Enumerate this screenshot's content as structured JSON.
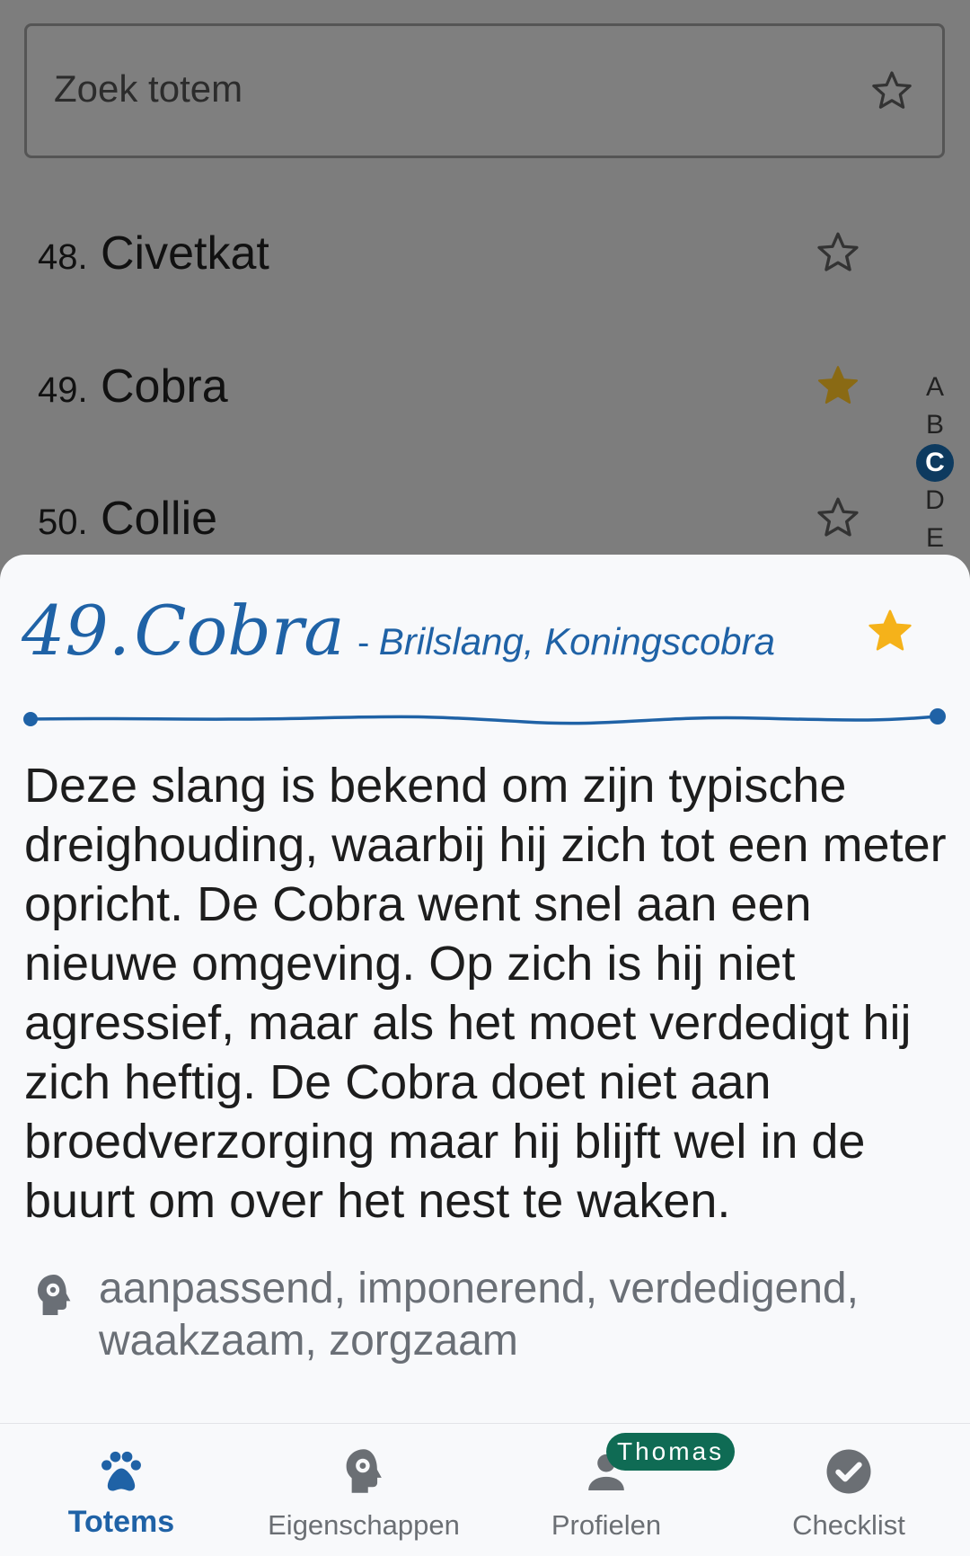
{
  "search": {
    "placeholder": "Zoek totem"
  },
  "list": [
    {
      "number": "48.",
      "name": "Civetkat",
      "favorite": false
    },
    {
      "number": "49.",
      "name": "Cobra",
      "favorite": true
    },
    {
      "number": "50.",
      "name": "Collie",
      "favorite": false
    }
  ],
  "alphabet": [
    "A",
    "B",
    "C",
    "D",
    "E"
  ],
  "alphabet_active": "C",
  "detail": {
    "number": "49.",
    "name": "Cobra",
    "separator": "-",
    "aliases": "Brilslang, Koningscobra",
    "favorite": true,
    "description": "Deze slang is bekend om zijn typische dreighouding, waarbij hij zich tot een meter opricht. De Cobra went snel aan een nieuwe omgeving. Op zich is hij niet agressief, maar als het moet verdedigt hij zich heftig. De Cobra doet niet aan broedverzorging maar hij blijft wel in de buurt om over het nest te waken.",
    "traits": "aanpassend, imponerend, verdedigend, waakzaam, zorgzaam"
  },
  "nav": {
    "items": [
      {
        "label": "Totems",
        "icon": "paw-icon",
        "active": true
      },
      {
        "label": "Eigenschappen",
        "icon": "head-gear-icon",
        "active": false
      },
      {
        "label": "Profielen",
        "icon": "person-icon",
        "active": false
      },
      {
        "label": "Checklist",
        "icon": "check-circle-icon",
        "active": false
      }
    ],
    "profile_badge": "Thomas"
  },
  "colors": {
    "accent": "#1f62a6",
    "star_gold": "#f5b21a",
    "star_gold_dim": "#8a6a14",
    "badge": "#0f6b54"
  }
}
